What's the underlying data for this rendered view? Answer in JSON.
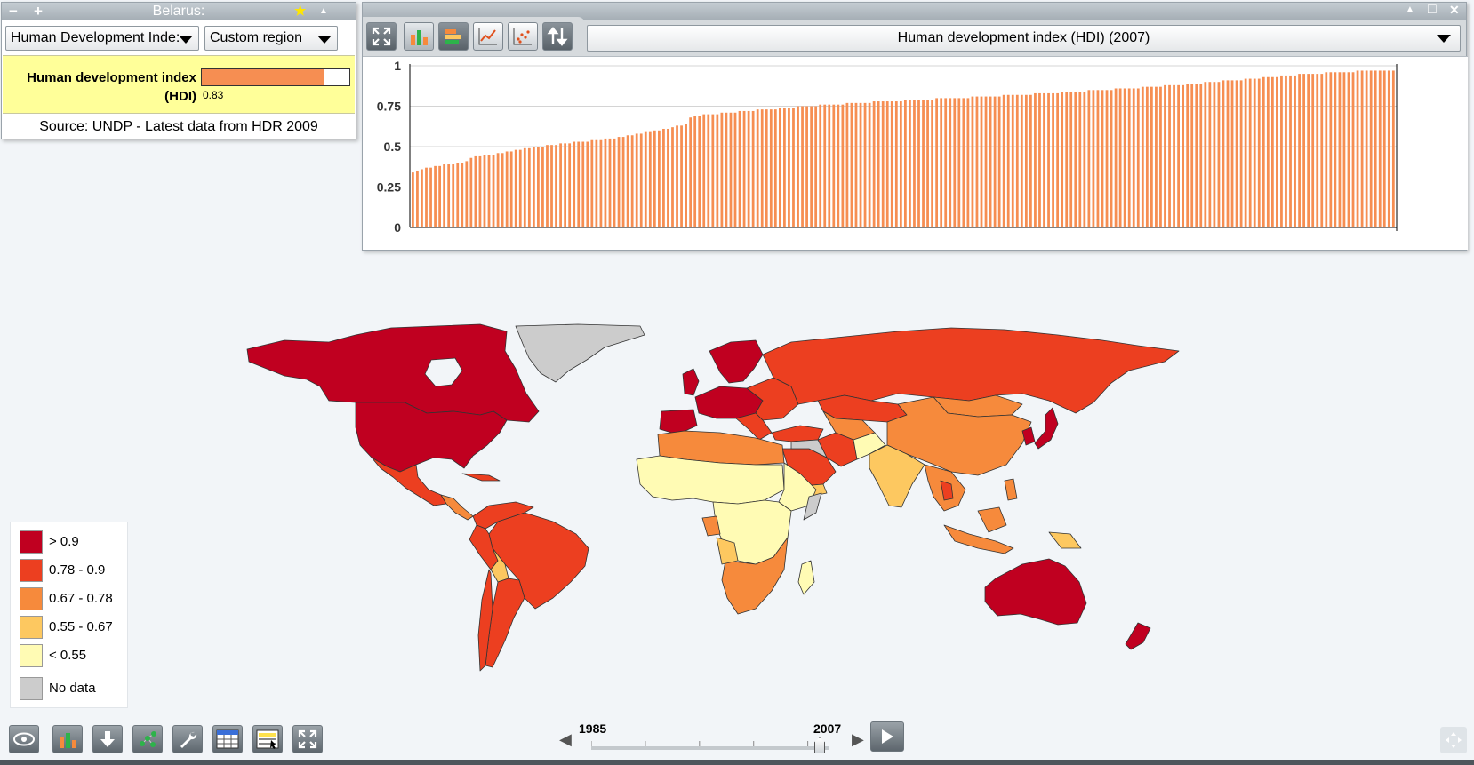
{
  "country_panel": {
    "title": "Belarus:",
    "minus": "−",
    "plus": "+",
    "star": "★",
    "collapse": "▲",
    "indicator_dropdown": "Human Development Inde:",
    "region_dropdown": "Custom region",
    "indicator_label": "Human development index (HDI)",
    "indicator_value": "0.83",
    "indicator_fraction": 0.83,
    "source": "Source: UNDP - Latest data from HDR 2009"
  },
  "chart_panel": {
    "selected_indicator": "Human development index (HDI) (2007)",
    "window_buttons": {
      "collapse": "▲",
      "maximize": "□",
      "close": "✕"
    },
    "tools": [
      "fullscreen-icon",
      "bar-chart-icon",
      "horizontal-bar-icon",
      "line-chart-icon",
      "scatter-plot-icon",
      "sort-icon"
    ]
  },
  "chart_data": {
    "type": "bar",
    "title": "",
    "xlabel": "",
    "ylabel": "",
    "ylim": [
      0,
      1
    ],
    "yticks": [
      "0",
      "0.25",
      "0.5",
      "0.75",
      "1"
    ],
    "bar_color": "#f68e52",
    "series": [
      {
        "values": [
          0.34,
          0.35,
          0.36,
          0.37,
          0.37,
          0.38,
          0.38,
          0.39,
          0.39,
          0.39,
          0.4,
          0.4,
          0.41,
          0.43,
          0.44,
          0.44,
          0.45,
          0.45,
          0.45,
          0.46,
          0.46,
          0.47,
          0.47,
          0.48,
          0.48,
          0.49,
          0.49,
          0.5,
          0.5,
          0.5,
          0.51,
          0.51,
          0.51,
          0.52,
          0.52,
          0.52,
          0.53,
          0.53,
          0.53,
          0.53,
          0.54,
          0.54,
          0.54,
          0.55,
          0.55,
          0.55,
          0.56,
          0.56,
          0.57,
          0.57,
          0.58,
          0.58,
          0.59,
          0.59,
          0.6,
          0.6,
          0.61,
          0.61,
          0.62,
          0.63,
          0.63,
          0.64,
          0.68,
          0.69,
          0.69,
          0.7,
          0.7,
          0.7,
          0.7,
          0.71,
          0.71,
          0.71,
          0.71,
          0.72,
          0.72,
          0.72,
          0.72,
          0.73,
          0.73,
          0.73,
          0.73,
          0.73,
          0.74,
          0.74,
          0.74,
          0.74,
          0.75,
          0.75,
          0.75,
          0.75,
          0.75,
          0.76,
          0.76,
          0.76,
          0.76,
          0.76,
          0.76,
          0.77,
          0.77,
          0.77,
          0.77,
          0.77,
          0.77,
          0.78,
          0.78,
          0.78,
          0.78,
          0.78,
          0.78,
          0.78,
          0.79,
          0.79,
          0.79,
          0.79,
          0.79,
          0.79,
          0.79,
          0.8,
          0.8,
          0.8,
          0.8,
          0.8,
          0.8,
          0.8,
          0.8,
          0.81,
          0.81,
          0.81,
          0.81,
          0.81,
          0.81,
          0.81,
          0.82,
          0.82,
          0.82,
          0.82,
          0.82,
          0.82,
          0.82,
          0.83,
          0.83,
          0.83,
          0.83,
          0.83,
          0.83,
          0.84,
          0.84,
          0.84,
          0.84,
          0.84,
          0.84,
          0.85,
          0.85,
          0.85,
          0.85,
          0.85,
          0.85,
          0.86,
          0.86,
          0.86,
          0.86,
          0.86,
          0.86,
          0.87,
          0.87,
          0.87,
          0.87,
          0.87,
          0.88,
          0.88,
          0.88,
          0.88,
          0.88,
          0.89,
          0.89,
          0.89,
          0.89,
          0.9,
          0.9,
          0.9,
          0.9,
          0.91,
          0.91,
          0.91,
          0.91,
          0.91,
          0.92,
          0.92,
          0.92,
          0.92,
          0.93,
          0.93,
          0.93,
          0.93,
          0.94,
          0.94,
          0.94,
          0.94,
          0.95,
          0.95,
          0.95,
          0.95,
          0.95,
          0.95,
          0.96,
          0.96,
          0.96,
          0.96,
          0.96,
          0.96,
          0.96,
          0.97,
          0.97,
          0.97,
          0.97,
          0.97,
          0.97,
          0.97,
          0.97,
          0.97
        ]
      }
    ]
  },
  "legend": {
    "items": [
      {
        "label": "> 0.9",
        "color": "#c00020"
      },
      {
        "label": "0.78 - 0.9",
        "color": "#ec3f20"
      },
      {
        "label": "0.67 - 0.78",
        "color": "#f68a3c"
      },
      {
        "label": "0.55 - 0.67",
        "color": "#fdc860"
      },
      {
        "label": "< 0.55",
        "color": "#fffbb4"
      },
      {
        "label": "No data",
        "color": "#cccccc"
      }
    ]
  },
  "map_colors": {
    "very_high": "#c00020",
    "high": "#ec3f20",
    "medium_high": "#f68a3c",
    "medium": "#fdc860",
    "low": "#fffbb4",
    "no_data": "#cccccc",
    "border": "#333333"
  },
  "timeline": {
    "start_year": "1985",
    "end_year": "2007",
    "left_arrow": "◀",
    "right_arrow": "▶",
    "play": "▶"
  },
  "bottom_toolbar": {
    "tools": [
      "eye-icon",
      "bar-chart-icon",
      "download-icon",
      "network-icon",
      "wrench-icon",
      "table-icon",
      "highlight-list-icon",
      "fullscreen-icon"
    ]
  }
}
